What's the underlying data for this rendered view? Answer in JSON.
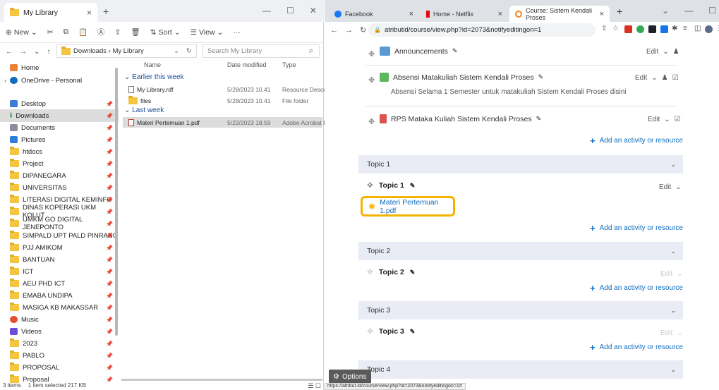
{
  "explorer": {
    "tab_title": "My Library",
    "tab_close": "×",
    "new_tab": "+",
    "win_controls": [
      "—",
      "☐",
      "✕"
    ],
    "toolbar": {
      "new": "New",
      "sort": "Sort",
      "view": "View",
      "more": "···"
    },
    "breadcrumb": "Downloads  ›  My Library",
    "search_placeholder": "Search My Library",
    "nav": [
      {
        "label": "Home",
        "color": "#e8833a"
      },
      {
        "label": "OneDrive - Personal",
        "color": "#0f6cbf"
      },
      {
        "label": "Desktop",
        "color": "#3a7bd5"
      },
      {
        "label": "Downloads",
        "color": "#2f9e44"
      },
      {
        "label": "Documents",
        "color": "#8a8fa0"
      },
      {
        "label": "Pictures",
        "color": "#2f7fd8"
      },
      {
        "label": "htdocs",
        "color": "#f5c542"
      },
      {
        "label": "Project",
        "color": "#f5c542"
      },
      {
        "label": "DIPANEGARA",
        "color": "#f5c542"
      },
      {
        "label": "UNIVERSITAS",
        "color": "#f5c542"
      },
      {
        "label": "LITERASI DIGITAL KEMINFO",
        "color": "#f5c542"
      },
      {
        "label": "DINAS KOPERASI UKM KOLUT",
        "color": "#f5c542"
      },
      {
        "label": "UMKM GO DIGITAL JENEPONTO",
        "color": "#f5c542"
      },
      {
        "label": "SIMPALD  UPT PALD PINRANG",
        "color": "#f5c542"
      },
      {
        "label": "PJJ AMIKOM",
        "color": "#f5c542"
      },
      {
        "label": "BANTUAN",
        "color": "#f5c542"
      },
      {
        "label": "ICT",
        "color": "#f5c542"
      },
      {
        "label": "AEU PHD ICT",
        "color": "#f5c542"
      },
      {
        "label": "EMABA UNDIPA",
        "color": "#f5c542"
      },
      {
        "label": "MASIGA KB MAKASSAR",
        "color": "#f5c542"
      },
      {
        "label": "Music",
        "color": "#e0502c"
      },
      {
        "label": "Videos",
        "color": "#6c4fd8"
      },
      {
        "label": "2023",
        "color": "#f5c542"
      },
      {
        "label": "PABLO",
        "color": "#f5c542"
      },
      {
        "label": "PROPOSAL",
        "color": "#f5c542"
      },
      {
        "label": "Proposal",
        "color": "#f5c542"
      }
    ],
    "columns": [
      "Name",
      "Date modified",
      "Type"
    ],
    "groups": {
      "earlier": "Earlier this week",
      "last": "Last week"
    },
    "files": [
      {
        "name": "My Library.rdf",
        "date": "5/28/2023 10.41",
        "type": "Resource Descripti..."
      },
      {
        "name": "files",
        "date": "5/28/2023 10.41",
        "type": "File folder"
      },
      {
        "name": "Materi Pertemuan 1.pdf",
        "date": "5/22/2023 18.59",
        "type": "Adobe Acrobat D..."
      }
    ],
    "status": {
      "items": "3 items",
      "selected": "1 item selected  217 KB"
    }
  },
  "browser": {
    "tabs": [
      {
        "title": "Facebook"
      },
      {
        "title": "Home - Netflix"
      },
      {
        "title": "Course: Sistem Kendali Proses"
      }
    ],
    "new_tab": "+",
    "url": "atributid/course/view.php?id=2073&notifyeditingon=1",
    "content": {
      "announcements": "Announcements",
      "edit": "Edit",
      "absensi": "Absensi Matakuliah Sistem Kendali Proses",
      "absensi_desc": "Absensi Selama 1 Semester untuk matakuliah Sistem Kendali Proses disini",
      "rps": "RPS Mataka Kuliah Sistem Kendali Proses",
      "add_activity": "Add an activity or resource",
      "topics": [
        {
          "header": "Topic 1",
          "title": "Topic 1"
        },
        {
          "header": "Topic 2",
          "title": "Topic 2"
        },
        {
          "header": "Topic 3",
          "title": "Topic 3"
        },
        {
          "header": "Topic 4",
          "title": ""
        }
      ],
      "materi_link": "Materi Pertemuan 1.pdf",
      "options": "Options",
      "status_url": "https://atribut.id/course/view.php?id=2073&notifyeditingon=1#"
    }
  }
}
